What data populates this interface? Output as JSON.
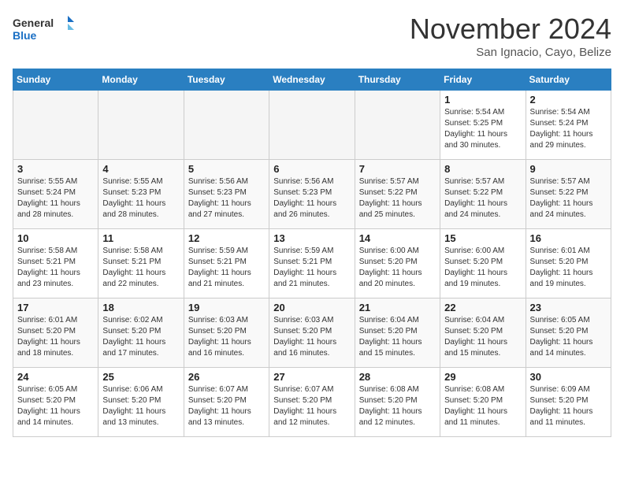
{
  "logo": {
    "general": "General",
    "blue": "Blue"
  },
  "title": "November 2024",
  "location": "San Ignacio, Cayo, Belize",
  "weekdays": [
    "Sunday",
    "Monday",
    "Tuesday",
    "Wednesday",
    "Thursday",
    "Friday",
    "Saturday"
  ],
  "weeks": [
    [
      {
        "day": "",
        "info": ""
      },
      {
        "day": "",
        "info": ""
      },
      {
        "day": "",
        "info": ""
      },
      {
        "day": "",
        "info": ""
      },
      {
        "day": "",
        "info": ""
      },
      {
        "day": "1",
        "info": "Sunrise: 5:54 AM\nSunset: 5:25 PM\nDaylight: 11 hours\nand 30 minutes."
      },
      {
        "day": "2",
        "info": "Sunrise: 5:54 AM\nSunset: 5:24 PM\nDaylight: 11 hours\nand 29 minutes."
      }
    ],
    [
      {
        "day": "3",
        "info": "Sunrise: 5:55 AM\nSunset: 5:24 PM\nDaylight: 11 hours\nand 28 minutes."
      },
      {
        "day": "4",
        "info": "Sunrise: 5:55 AM\nSunset: 5:23 PM\nDaylight: 11 hours\nand 28 minutes."
      },
      {
        "day": "5",
        "info": "Sunrise: 5:56 AM\nSunset: 5:23 PM\nDaylight: 11 hours\nand 27 minutes."
      },
      {
        "day": "6",
        "info": "Sunrise: 5:56 AM\nSunset: 5:23 PM\nDaylight: 11 hours\nand 26 minutes."
      },
      {
        "day": "7",
        "info": "Sunrise: 5:57 AM\nSunset: 5:22 PM\nDaylight: 11 hours\nand 25 minutes."
      },
      {
        "day": "8",
        "info": "Sunrise: 5:57 AM\nSunset: 5:22 PM\nDaylight: 11 hours\nand 24 minutes."
      },
      {
        "day": "9",
        "info": "Sunrise: 5:57 AM\nSunset: 5:22 PM\nDaylight: 11 hours\nand 24 minutes."
      }
    ],
    [
      {
        "day": "10",
        "info": "Sunrise: 5:58 AM\nSunset: 5:21 PM\nDaylight: 11 hours\nand 23 minutes."
      },
      {
        "day": "11",
        "info": "Sunrise: 5:58 AM\nSunset: 5:21 PM\nDaylight: 11 hours\nand 22 minutes."
      },
      {
        "day": "12",
        "info": "Sunrise: 5:59 AM\nSunset: 5:21 PM\nDaylight: 11 hours\nand 21 minutes."
      },
      {
        "day": "13",
        "info": "Sunrise: 5:59 AM\nSunset: 5:21 PM\nDaylight: 11 hours\nand 21 minutes."
      },
      {
        "day": "14",
        "info": "Sunrise: 6:00 AM\nSunset: 5:20 PM\nDaylight: 11 hours\nand 20 minutes."
      },
      {
        "day": "15",
        "info": "Sunrise: 6:00 AM\nSunset: 5:20 PM\nDaylight: 11 hours\nand 19 minutes."
      },
      {
        "day": "16",
        "info": "Sunrise: 6:01 AM\nSunset: 5:20 PM\nDaylight: 11 hours\nand 19 minutes."
      }
    ],
    [
      {
        "day": "17",
        "info": "Sunrise: 6:01 AM\nSunset: 5:20 PM\nDaylight: 11 hours\nand 18 minutes."
      },
      {
        "day": "18",
        "info": "Sunrise: 6:02 AM\nSunset: 5:20 PM\nDaylight: 11 hours\nand 17 minutes."
      },
      {
        "day": "19",
        "info": "Sunrise: 6:03 AM\nSunset: 5:20 PM\nDaylight: 11 hours\nand 16 minutes."
      },
      {
        "day": "20",
        "info": "Sunrise: 6:03 AM\nSunset: 5:20 PM\nDaylight: 11 hours\nand 16 minutes."
      },
      {
        "day": "21",
        "info": "Sunrise: 6:04 AM\nSunset: 5:20 PM\nDaylight: 11 hours\nand 15 minutes."
      },
      {
        "day": "22",
        "info": "Sunrise: 6:04 AM\nSunset: 5:20 PM\nDaylight: 11 hours\nand 15 minutes."
      },
      {
        "day": "23",
        "info": "Sunrise: 6:05 AM\nSunset: 5:20 PM\nDaylight: 11 hours\nand 14 minutes."
      }
    ],
    [
      {
        "day": "24",
        "info": "Sunrise: 6:05 AM\nSunset: 5:20 PM\nDaylight: 11 hours\nand 14 minutes."
      },
      {
        "day": "25",
        "info": "Sunrise: 6:06 AM\nSunset: 5:20 PM\nDaylight: 11 hours\nand 13 minutes."
      },
      {
        "day": "26",
        "info": "Sunrise: 6:07 AM\nSunset: 5:20 PM\nDaylight: 11 hours\nand 13 minutes."
      },
      {
        "day": "27",
        "info": "Sunrise: 6:07 AM\nSunset: 5:20 PM\nDaylight: 11 hours\nand 12 minutes."
      },
      {
        "day": "28",
        "info": "Sunrise: 6:08 AM\nSunset: 5:20 PM\nDaylight: 11 hours\nand 12 minutes."
      },
      {
        "day": "29",
        "info": "Sunrise: 6:08 AM\nSunset: 5:20 PM\nDaylight: 11 hours\nand 11 minutes."
      },
      {
        "day": "30",
        "info": "Sunrise: 6:09 AM\nSunset: 5:20 PM\nDaylight: 11 hours\nand 11 minutes."
      }
    ]
  ]
}
